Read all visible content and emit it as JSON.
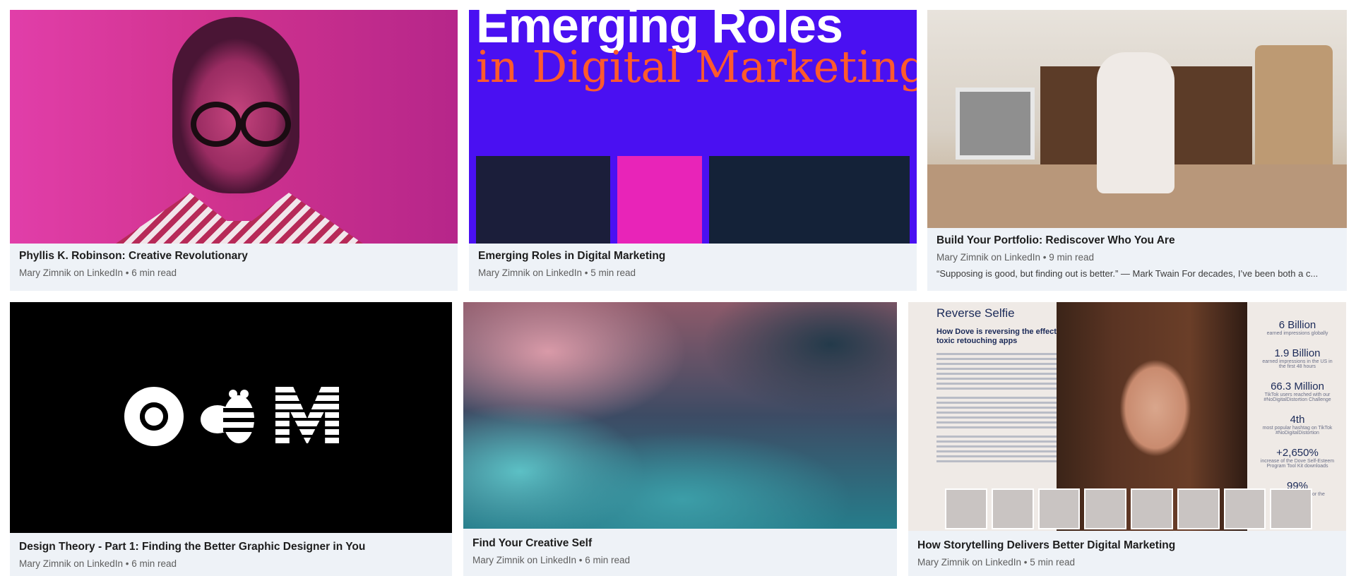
{
  "cards": [
    {
      "title": "Phyllis K. Robinson: Creative Revolutionary",
      "byline": "Mary Zimnik on LinkedIn • 6 min read"
    },
    {
      "title": "Emerging Roles in Digital Marketing",
      "byline": "Mary Zimnik on LinkedIn • 5 min read",
      "image_text": {
        "headline": "Emerging Roles",
        "subline": "in Digital Marketing"
      }
    },
    {
      "title": "Build Your Portfolio: Rediscover Who You Are",
      "byline": "Mary Zimnik on LinkedIn • 9 min read",
      "excerpt": "“Supposing is good, but finding out is better.” — Mark Twain For decades, I’ve been both a c..."
    },
    {
      "title": "Design Theory - Part 1: Finding the Better Graphic Designer in You",
      "byline": "Mary Zimnik on LinkedIn • 6 min read"
    },
    {
      "title": "Find Your Creative Self",
      "byline": "Mary Zimnik on LinkedIn • 6 min read"
    },
    {
      "title": "How Storytelling Delivers Better Digital Marketing",
      "byline": "Mary Zimnik on LinkedIn • 5 min read",
      "image_text": {
        "title": "Reverse Selfie",
        "subtitle": "How Dove is reversing the effects of toxic retouching apps",
        "stats": [
          {
            "value": "6 Billion",
            "label": "earned impressions globally"
          },
          {
            "value": "1.9 Billion",
            "label": "earned impressions in the US in the first 48 hours"
          },
          {
            "value": "66.3 Million",
            "label": "TikTok users reached with our #NoDigitalDistortion Challenge"
          },
          {
            "value": "4th",
            "label": "most popular hashtag on TikTok #NoDigitalDistortion"
          },
          {
            "value": "+2,650%",
            "label": "increase of the Dove Self-Esteem Program Tool Kit downloads"
          },
          {
            "value": "99%",
            "label": "positive sentiment for the campaign"
          }
        ]
      }
    }
  ],
  "colors": {
    "card_bg": "#eef2f7",
    "title_text": "#1d1d1d",
    "meta_text": "#5e5e5e"
  }
}
